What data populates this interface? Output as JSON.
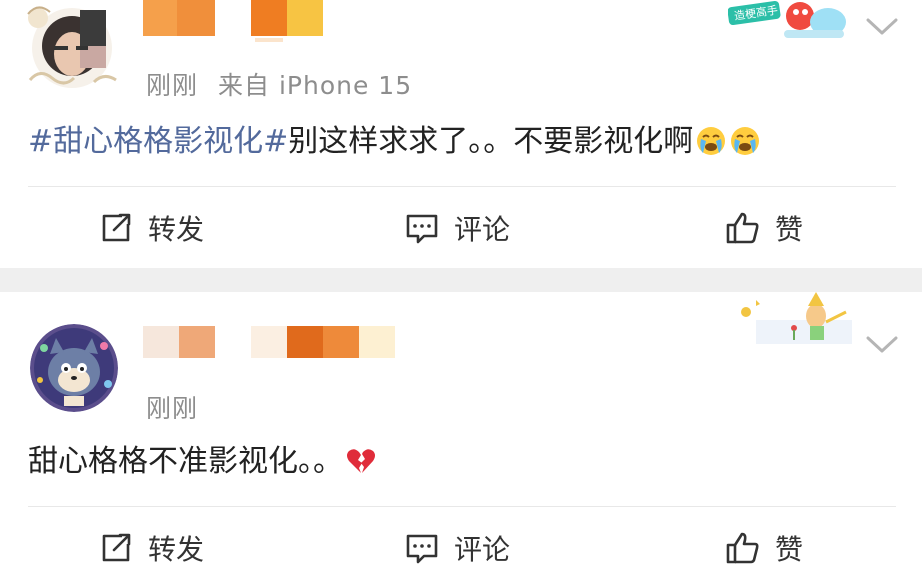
{
  "posts": [
    {
      "avatar_icon": "user-avatar-photo",
      "time": "刚刚",
      "source": "来自 iPhone 15",
      "body": {
        "hashtag": "#甜心格格影视化#",
        "text": "别这样求求了。。不要影视化啊"
      },
      "emoji": "crying-emoji",
      "badge_text": "造梗高手",
      "actions": {
        "repost": "转发",
        "comment": "评论",
        "like": "赞"
      }
    },
    {
      "avatar_icon": "cartoon-cat-avatar",
      "time": "刚刚",
      "body": {
        "text": "甜心格格不准影视化。。"
      },
      "emoji": "broken-heart-emoji",
      "actions": {
        "repost": "转发",
        "comment": "评论",
        "like": "赞"
      }
    }
  ],
  "colors": {
    "hashtag": "#536a9c",
    "meta": "#8d8d8d",
    "separator": "#efefef",
    "username_blur_orange": "#e8782c",
    "username_blur_yellow": "#f7c443"
  }
}
